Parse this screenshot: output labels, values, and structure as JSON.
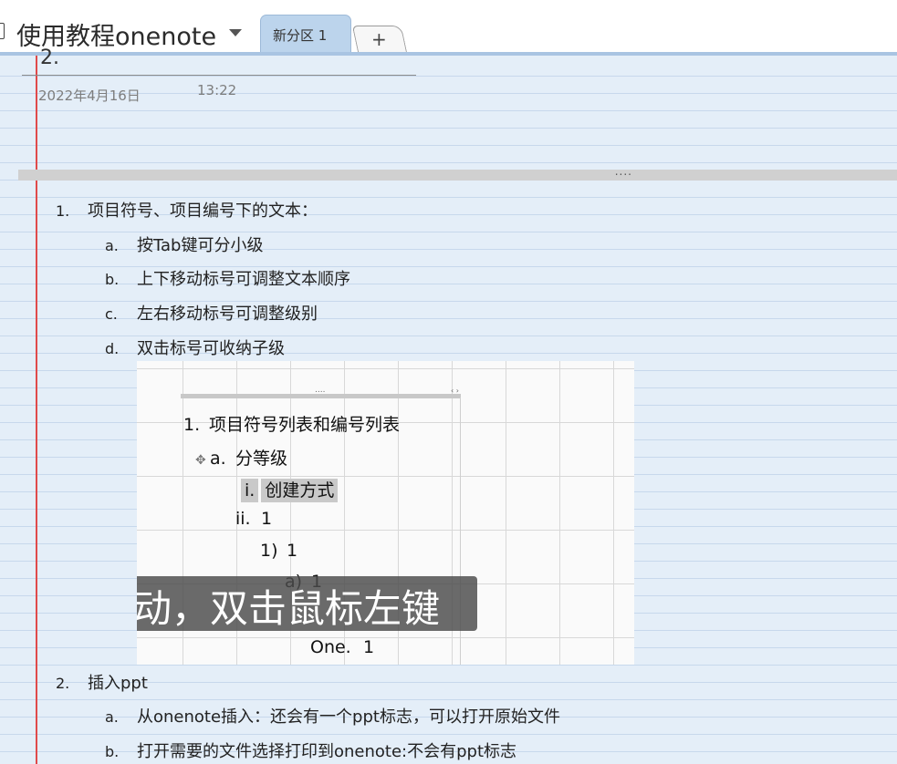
{
  "header": {
    "notebook_title": "使用教程onenote",
    "section_tab_label": "新分区 1",
    "add_tab_label": "+"
  },
  "page": {
    "title_fragment": "2.",
    "date": "2022年4月16日",
    "time": "13:22",
    "container_handle": "....",
    "outline": [
      {
        "num": "1.",
        "text": "项目符号、项目编号下的文本："
      },
      {
        "num": "a.",
        "text": "按Tab键可分小级"
      },
      {
        "num": "b.",
        "text": "上下移动标号可调整文本顺序"
      },
      {
        "num": "c.",
        "text": "左右移动标号可调整级别"
      },
      {
        "num": "d.",
        "text": "双击标号可收纳子级"
      },
      {
        "num": "2.",
        "text": "插入ppt"
      },
      {
        "num": "a.",
        "text": "从onenote插入：还会有一个ppt标志，可以打开原始文件"
      },
      {
        "num": "b.",
        "text": "打开需要的文件选择打印到onenote:不会有ppt标志"
      }
    ]
  },
  "embedded_image": {
    "handle_dots": "....",
    "handle_arrows": "‹ ›",
    "lines": [
      {
        "num": "1.",
        "text": "项目符号列表和编号列表"
      },
      {
        "num": "a.",
        "text": "分等级"
      },
      {
        "num": "i.",
        "text": "创建方式"
      },
      {
        "num": "ii.",
        "text": "1"
      },
      {
        "num": "1)",
        "text": "1"
      },
      {
        "num": "a)",
        "text": "1"
      },
      {
        "num": "One.",
        "text": "1"
      }
    ],
    "caption": "动，双击鼠标左键"
  }
}
